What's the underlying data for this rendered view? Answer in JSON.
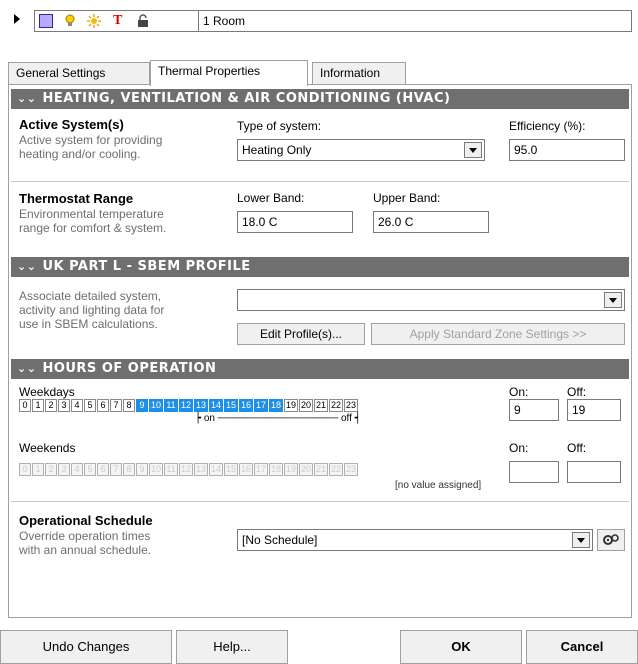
{
  "toolbar": {
    "room_name": "1 Room",
    "icons": [
      "square-icon",
      "bulb-icon",
      "sun-icon",
      "text-icon",
      "lock-icon"
    ]
  },
  "tabs": [
    {
      "label": "General Settings",
      "active": false
    },
    {
      "label": "Thermal Properties",
      "active": true
    },
    {
      "label": "Information",
      "active": false
    }
  ],
  "hvac": {
    "header": "HEATING, VENTILATION & AIR CONDITIONING (HVAC)",
    "active_system": {
      "title": "Active System(s)",
      "desc1": "Active system for providing",
      "desc2": "heating and/or cooling."
    },
    "type_label": "Type of system:",
    "type_value": "Heating Only",
    "efficiency_label": "Efficiency (%):",
    "efficiency_value": "95.0",
    "thermostat": {
      "title": "Thermostat Range",
      "desc1": "Environmental temperature",
      "desc2": "range for comfort & system."
    },
    "lower_label": "Lower Band:",
    "lower_value": "18.0 C",
    "upper_label": "Upper Band:",
    "upper_value": "26.0 C"
  },
  "sbem": {
    "header": "UK PART L - SBEM PROFILE",
    "desc1": "Associate detailed system,",
    "desc2": "activity and lighting data for",
    "desc3": "use in SBEM calculations.",
    "profile_value": "",
    "edit_button": "Edit Profile(s)...",
    "apply_button": "Apply Standard Zone Settings >>"
  },
  "hours": {
    "header": "HOURS OF OPERATION",
    "weekdays_label": "Weekdays",
    "weekends_label": "Weekends",
    "on_label": "On:",
    "off_label": "Off:",
    "weekday_hours": [
      "0",
      "1",
      "2",
      "3",
      "4",
      "5",
      "6",
      "7",
      "8",
      "9",
      "10",
      "11",
      "12",
      "13",
      "14",
      "15",
      "16",
      "17",
      "18",
      "19",
      "20",
      "21",
      "22",
      "23"
    ],
    "weekday_on_hour": 9,
    "weekday_off_hour": 19,
    "weekday_on_value": "9",
    "weekday_off_value": "19",
    "on_marker": "on",
    "off_marker": "off",
    "weekend_on_value": "",
    "weekend_off_value": "",
    "no_value": "[no value assigned]"
  },
  "schedule": {
    "title": "Operational Schedule",
    "desc1": "Override operation times",
    "desc2": "with an annual schedule.",
    "value": "[No Schedule]"
  },
  "buttons": {
    "undo": "Undo Changes",
    "help": "Help...",
    "ok": "OK",
    "cancel": "Cancel"
  },
  "colors": {
    "section_header": "#6f6f6f",
    "hour_selected": "#1e8fe6"
  }
}
